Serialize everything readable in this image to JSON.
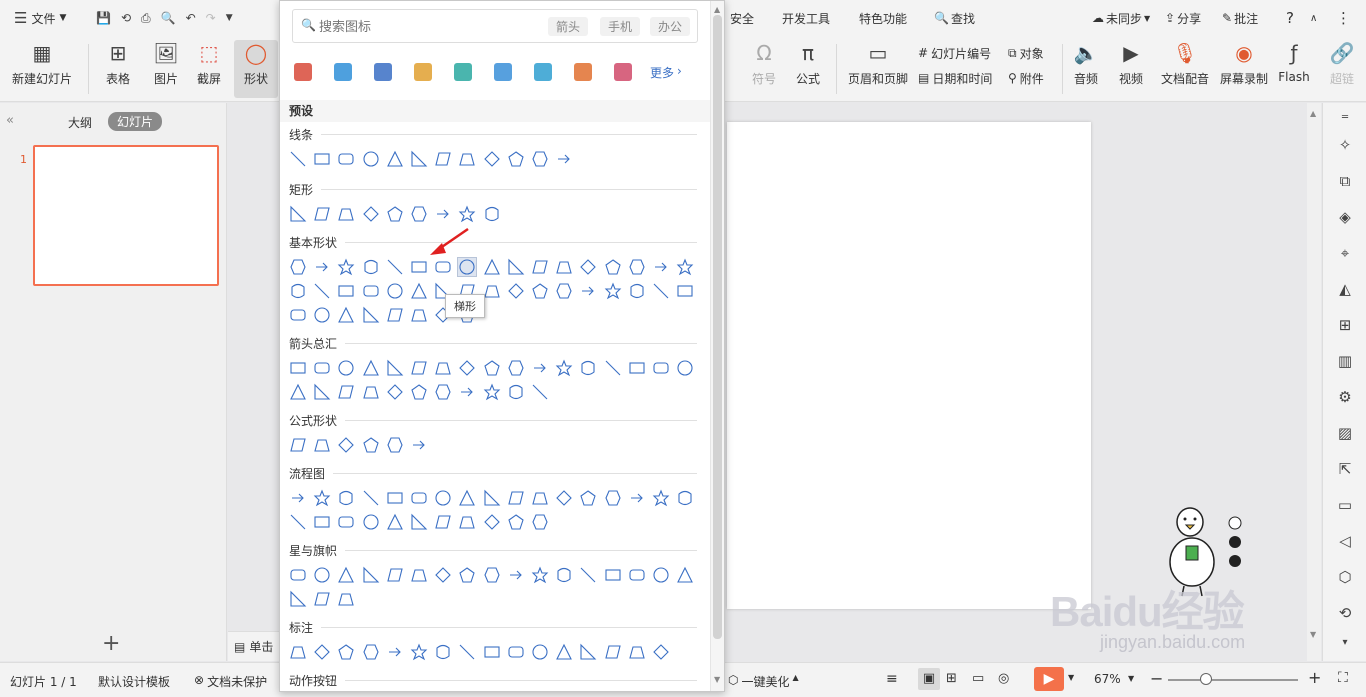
{
  "menu": {
    "file_label": "文件",
    "tabs": [
      "安全",
      "开发工具",
      "特色功能"
    ],
    "search_label": "查找",
    "sync": "未同步",
    "share": "分享",
    "comment": "批注",
    "help": "?"
  },
  "ribbon": {
    "new_slide": "新建幻灯片",
    "table": "表格",
    "picture": "图片",
    "screenshot": "截屏",
    "shape": "形状",
    "symbol": "符号",
    "formula": "公式",
    "header_footer": "页眉和页脚",
    "slide_number": "幻灯片编号",
    "object": "对象",
    "date_time": "日期和时间",
    "attachment": "附件",
    "audio": "音频",
    "video": "视频",
    "doc_voice": "文档配音",
    "screen_record": "屏幕录制",
    "flash": "Flash",
    "hyperlink": "超链"
  },
  "left_panel": {
    "outline_tab": "大纲",
    "slides_tab": "幻灯片",
    "slide_index": "1",
    "add": "+"
  },
  "popup": {
    "search_placeholder": "搜索图标",
    "tags": [
      "箭头",
      "手机",
      "办公"
    ],
    "more": "更多",
    "preset_title": "预设",
    "sections": [
      {
        "title": "线条",
        "count": 12
      },
      {
        "title": "矩形",
        "count": 9
      },
      {
        "title": "基本形状",
        "count": 42
      },
      {
        "title": "箭头总汇",
        "count": 28
      },
      {
        "title": "公式形状",
        "count": 6
      },
      {
        "title": "流程图",
        "count": 28
      },
      {
        "title": "星与旗帜",
        "count": 20
      },
      {
        "title": "标注",
        "count": 16
      },
      {
        "title": "动作按钮",
        "count": 0
      }
    ],
    "tooltip": "梯形"
  },
  "slide_side": {
    "notes_label": "单击"
  },
  "statusbar": {
    "slide_info": "幻灯片 1 / 1",
    "template": "默认设计模板",
    "protect": "文档未保护",
    "beautify": "一键美化",
    "zoom": "67%",
    "zoom_level": 0.4
  },
  "colors": {
    "accent": "#f4511e",
    "shape_stroke": "#3a6fc4",
    "slide_border": "#f47050",
    "play": "#f4714a"
  },
  "watermark": {
    "brand": "Baidu经验",
    "url": "jingyan.baidu.com"
  }
}
